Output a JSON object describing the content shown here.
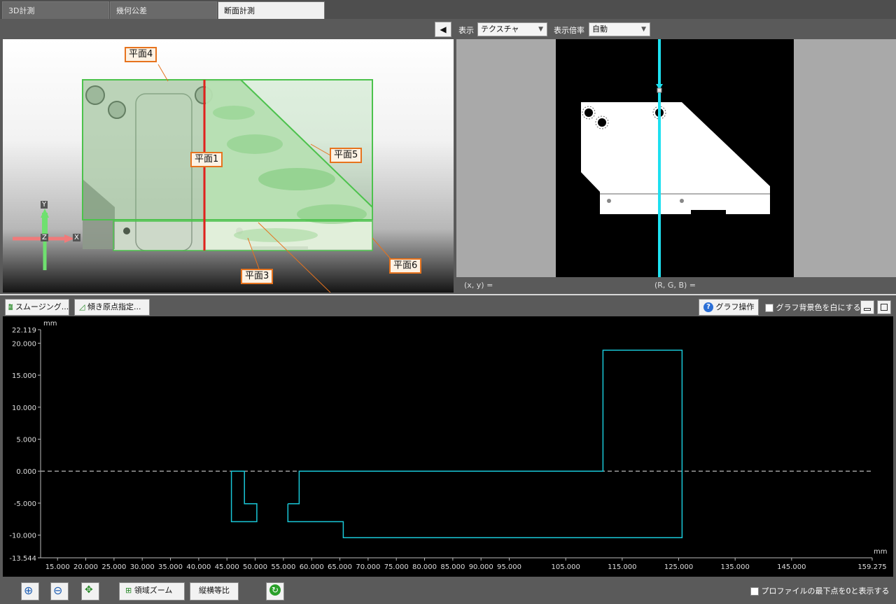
{
  "tabs": [
    {
      "label": "3D計測",
      "active": false
    },
    {
      "label": "幾何公差",
      "active": false
    },
    {
      "label": "断面計測",
      "active": true
    }
  ],
  "view3d": {
    "plane_labels": [
      "平面4",
      "平面1",
      "平面5",
      "平面3",
      "平面6"
    ],
    "axis": {
      "y": "Y",
      "z": "Z",
      "x": "X"
    }
  },
  "right_panel": {
    "display_label": "表示",
    "display_value": "テクスチャ",
    "zoom_label": "表示倍率",
    "zoom_value": "自動",
    "status_xy": "(x, y)  =",
    "status_rgb": "(R, G, B)  ="
  },
  "graph_toolbar": {
    "smoothing_button": "スムージング...",
    "tilt_origin_button": "傾き原点指定...",
    "graph_operation_button": "グラフ操作",
    "white_bg_label": "グラフ背景色を白にする"
  },
  "bottom_toolbar": {
    "area_zoom_button": "領域ズーム",
    "aspect_button": "縦横等比",
    "min_zero_label": "プロファイルの最下点を0と表示する"
  },
  "colors": {
    "profile": "#19c8d8",
    "plane_box": "#4cc24c",
    "label_border": "#e6731e",
    "section_line": "#e0221c",
    "cursor_line": "#1ee0f0"
  },
  "chart_data": {
    "type": "line",
    "x_unit": "mm",
    "y_unit": "mm",
    "xlim": [
      12.0,
      159.275
    ],
    "ylim": [
      -13.544,
      22.119
    ],
    "x_ticks": [
      15,
      20,
      25,
      30,
      35,
      40,
      45,
      50,
      55,
      60,
      65,
      70,
      75,
      80,
      85,
      90,
      95,
      105,
      115,
      125,
      135,
      145,
      159.275
    ],
    "x_tick_labels": [
      "15.000",
      "20.000",
      "25.000",
      "30.000",
      "35.000",
      "40.000",
      "45.000",
      "50.000",
      "55.000",
      "60.000",
      "65.000",
      "70.000",
      "75.000",
      "80.000",
      "85.000",
      "90.000",
      "95.000",
      "105.000",
      "115.000",
      "125.000",
      "135.000",
      "145.000",
      "159.275"
    ],
    "y_ticks": [
      22.119,
      20,
      15,
      10,
      5,
      0,
      -5,
      -10,
      -13.544
    ],
    "y_tick_labels": [
      "22.119",
      "20.000",
      "15.000",
      "10.000",
      "5.000",
      "0.000",
      "-5.000",
      "-10.000",
      "-13.544"
    ],
    "reference_line_y": 0,
    "series": [
      {
        "points": [
          [
            45.8,
            0
          ],
          [
            45.8,
            -7.9
          ],
          [
            50.3,
            -7.9
          ],
          [
            50.3,
            -5.1
          ],
          [
            48.1,
            -5.1
          ],
          [
            48.1,
            0
          ],
          [
            45.8,
            0
          ]
        ]
      },
      {
        "points": [
          [
            55.8,
            -5.1
          ],
          [
            55.8,
            -7.9
          ],
          [
            65.6,
            -7.9
          ],
          [
            65.6,
            -10.4
          ],
          [
            125.6,
            -10.4
          ],
          [
            125.6,
            18.9
          ],
          [
            111.6,
            18.9
          ],
          [
            111.6,
            0
          ],
          [
            57.8,
            0
          ],
          [
            57.8,
            -5.1
          ],
          [
            55.8,
            -5.1
          ]
        ]
      }
    ]
  }
}
